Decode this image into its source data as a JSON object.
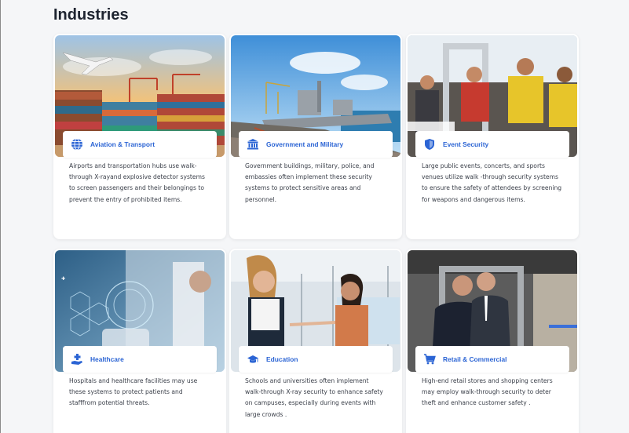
{
  "page": {
    "title": "Industries"
  },
  "accent_color": "#2b64d4",
  "cards": [
    {
      "title": "Aviation & Transport",
      "icon": "globe-icon",
      "description": "Airports and transportation hubs use walk-through X-rayand explosive detector systems to screen passengers and their belongings to prevent the entry of prohibited items."
    },
    {
      "title": "Government and Military",
      "icon": "government-building-icon",
      "description": "Government buildings, military, police, and embassies often implement these security systems to protect sensitive areas and personnel."
    },
    {
      "title": "Event Security",
      "icon": "shield-icon",
      "description": "Large public events, concerts, and sports venues utilize walk -through security systems to ensure the safety of attendees by screening for weapons and dangerous items."
    },
    {
      "title": "Healthcare",
      "icon": "hand-medical-icon",
      "description": "Hospitals and healthcare facilities may use these systems to protect patients and stafffrom potential threats."
    },
    {
      "title": "Education",
      "icon": "graduation-cap-icon",
      "description": "Schools and universities often implement walk-through X-ray security to enhance safety on campuses, especially during events with large crowds ."
    },
    {
      "title": "Retail & Commercial",
      "icon": "shopping-cart-icon",
      "description": "High-end retail stores and shopping centers may employ walk-through security to deter theft and enhance customer safety ."
    }
  ]
}
